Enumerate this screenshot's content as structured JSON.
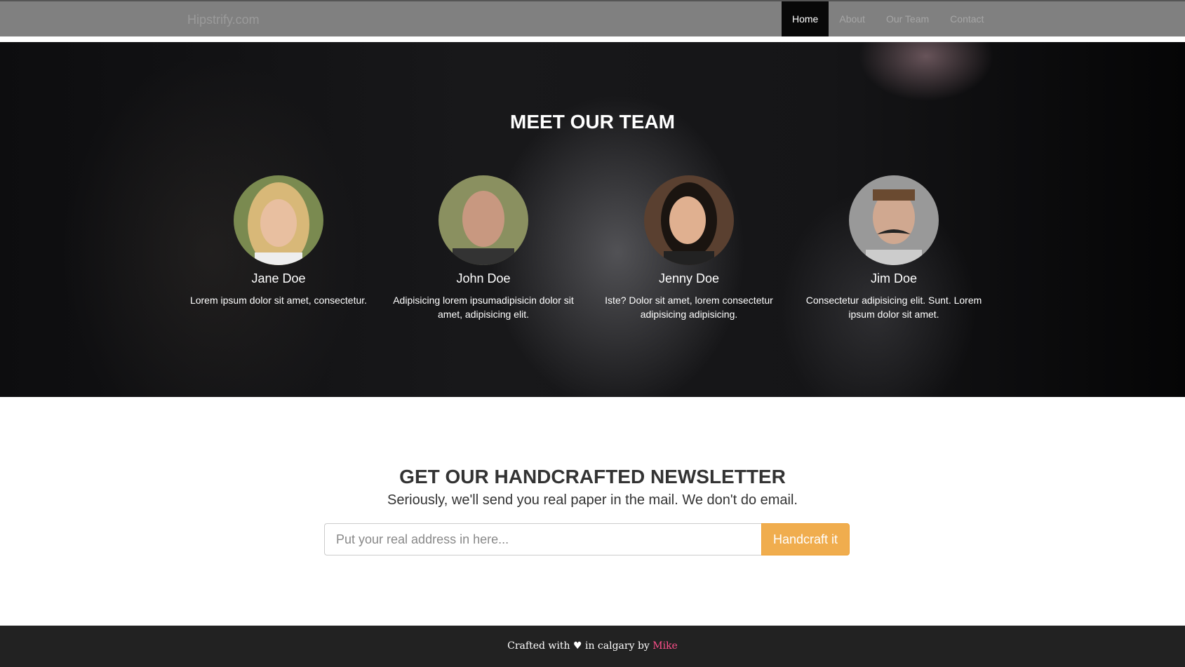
{
  "nav": {
    "brand": "Hipstrify.com",
    "items": [
      {
        "label": "Home",
        "active": true
      },
      {
        "label": "About"
      },
      {
        "label": "Our Team"
      },
      {
        "label": "Contact"
      }
    ]
  },
  "team": {
    "title": "MEET OUR TEAM",
    "members": [
      {
        "name": "Jane Doe",
        "bio": "Lorem ipsum dolor sit amet, consectetur."
      },
      {
        "name": "John Doe",
        "bio": "Adipisicing lorem ipsumadipisicin dolor sit amet, adipisicing elit."
      },
      {
        "name": "Jenny Doe",
        "bio": "Iste? Dolor sit amet, lorem consectetur adipisicing adipisicing."
      },
      {
        "name": "Jim Doe",
        "bio": "Consectetur adipisicing elit. Sunt. Lorem ipsum dolor sit amet."
      }
    ]
  },
  "newsletter": {
    "title": "GET OUR HANDCRAFTED NEWSLETTER",
    "subtitle": "Seriously, we'll send you real paper in the mail. We don't do email.",
    "placeholder": "Put your real address in here...",
    "button": "Handcraft it",
    "button_color": "#f0ad4e"
  },
  "footer": {
    "prefix": "Crafted with",
    "heart": "♥",
    "middle": "in calgary by",
    "author": "Mike",
    "author_color": "#ff4f8b"
  }
}
